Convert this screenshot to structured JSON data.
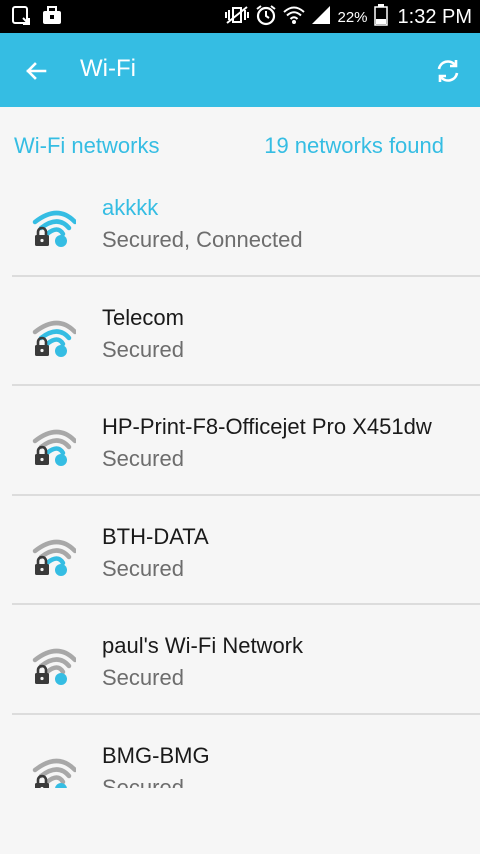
{
  "status_bar": {
    "battery": "22%",
    "time": "1:32 PM"
  },
  "app_bar": {
    "title": "Wi-Fi",
    "back_icon": "arrow-left-icon",
    "refresh_icon": "refresh-icon"
  },
  "section": {
    "label": "Wi-Fi networks",
    "count_text": "19 networks found"
  },
  "networks": [
    {
      "ssid": "akkkk",
      "status": "Secured, Connected",
      "signal_bars": 4,
      "connected": true
    },
    {
      "ssid": "Telecom",
      "status": "Secured",
      "signal_bars": 3,
      "connected": false
    },
    {
      "ssid": "HP-Print-F8-Officejet Pro X451dw",
      "status": "Secured",
      "signal_bars": 2,
      "connected": false
    },
    {
      "ssid": "BTH-DATA",
      "status": "Secured",
      "signal_bars": 2,
      "connected": false
    },
    {
      "ssid": "paul's Wi-Fi Network",
      "status": "Secured",
      "signal_bars": 1,
      "connected": false
    },
    {
      "ssid": "BMG-BMG",
      "status": "Secured",
      "signal_bars": 1,
      "connected": false
    }
  ],
  "colors": {
    "accent": "#35bde3",
    "inactive_arc": "#a8a8a8",
    "lock": "#3a3a3a"
  }
}
